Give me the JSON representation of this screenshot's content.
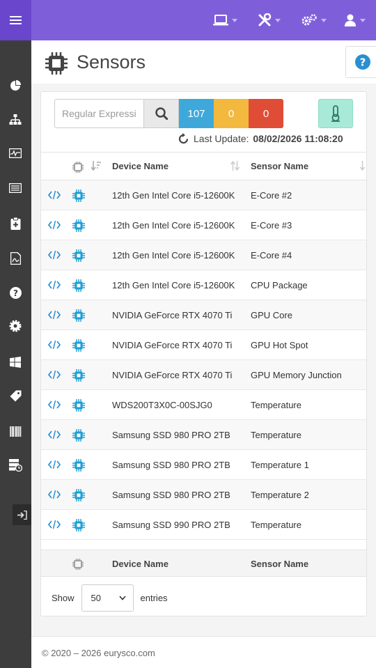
{
  "topbar": {
    "menu_icon": "hamburger-icon",
    "icons": [
      "laptop-icon",
      "tools-icon",
      "gears-icon",
      "user-icon"
    ]
  },
  "sidebar": {
    "items": [
      "pie-chart-icon",
      "sitemap-icon",
      "monitor-wave-icon",
      "list-icon",
      "clipboard-plus-icon",
      "pdf-file-icon",
      "help-circle-icon",
      "cog-icon",
      "windows-icon",
      "tag-icon",
      "barcode-icon",
      "server-clock-icon"
    ],
    "exit_icon": "sign-out-icon"
  },
  "header": {
    "title": "Sensors",
    "title_icon": "chip-icon",
    "help_icon": "help-circle-icon"
  },
  "search": {
    "placeholder": "Regular Expressi",
    "value": ""
  },
  "counts": {
    "ok": "107",
    "warning": "0",
    "error": "0"
  },
  "last_update": {
    "label": "Last Update:",
    "value": "08/02/2026 11:08:20"
  },
  "table": {
    "columns": {
      "device": "Device Name",
      "sensor": "Sensor Name"
    },
    "rows": [
      {
        "device": "12th Gen Intel Core i5-12600K",
        "sensor": "E-Core #2"
      },
      {
        "device": "12th Gen Intel Core i5-12600K",
        "sensor": "E-Core #3"
      },
      {
        "device": "12th Gen Intel Core i5-12600K",
        "sensor": "E-Core #4"
      },
      {
        "device": "12th Gen Intel Core i5-12600K",
        "sensor": "CPU Package"
      },
      {
        "device": "NVIDIA GeForce RTX 4070 Ti",
        "sensor": "GPU Core"
      },
      {
        "device": "NVIDIA GeForce RTX 4070 Ti",
        "sensor": "GPU Hot Spot"
      },
      {
        "device": "NVIDIA GeForce RTX 4070 Ti",
        "sensor": "GPU Memory Junction"
      },
      {
        "device": "WDS200T3X0C-00SJG0",
        "sensor": "Temperature"
      },
      {
        "device": "Samsung SSD 980 PRO 2TB",
        "sensor": "Temperature"
      },
      {
        "device": "Samsung SSD 980 PRO 2TB",
        "sensor": "Temperature 1"
      },
      {
        "device": "Samsung SSD 980 PRO 2TB",
        "sensor": "Temperature 2"
      },
      {
        "device": "Samsung SSD 990 PRO 2TB",
        "sensor": "Temperature"
      }
    ],
    "footer": {
      "device": "Device Name",
      "sensor": "Sensor Name"
    }
  },
  "length": {
    "show": "Show",
    "value": "50",
    "entries": "entries"
  },
  "footer": {
    "copyright": "© 2020 – 2026 eurysco.com"
  },
  "colors": {
    "topbar": "#7f5fd9",
    "sidebar": "#3d3d3d",
    "ok": "#3fa8db",
    "warning": "#f2b93e",
    "error": "#e04d36",
    "accent": "#2a8fd0"
  }
}
